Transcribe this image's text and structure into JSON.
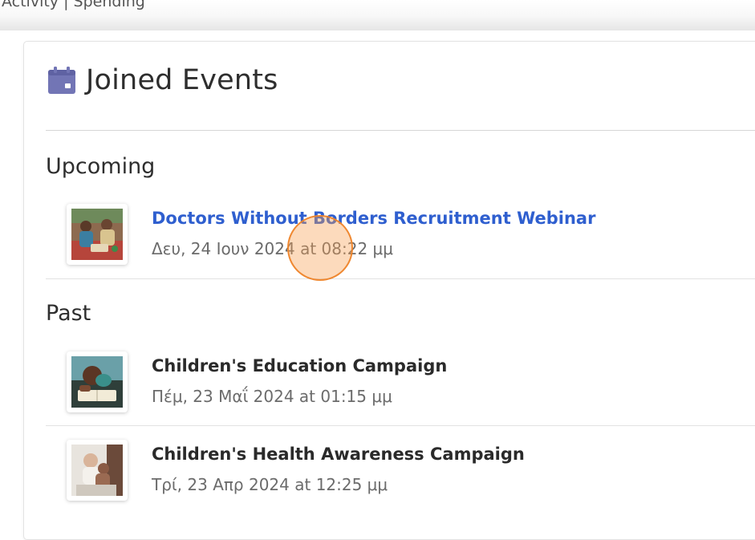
{
  "topbar": {
    "partial_text": "Activity | Spending"
  },
  "card": {
    "title": "Joined Events",
    "title_icon": "calendar-icon",
    "icon_color": "#7275b5"
  },
  "sections": {
    "upcoming": {
      "heading": "Upcoming",
      "events": [
        {
          "title": "Doctors Without Borders Recruitment Webinar",
          "date": "Δευ, 24 Ιουν 2024 at 08:22 μμ",
          "thumbnail": "volunteers-photo",
          "title_color": "#2f5fcf"
        }
      ]
    },
    "past": {
      "heading": "Past",
      "events": [
        {
          "title": "Children's Education Campaign",
          "date": "Πέμ, 23 Μαΐ 2024 at 01:15 μμ",
          "thumbnail": "child-reading-photo"
        },
        {
          "title": "Children's Health Awareness Campaign",
          "date": "Τρί, 23 Απρ 2024 at 12:25 μμ",
          "thumbnail": "mother-child-photo"
        }
      ]
    }
  },
  "colors": {
    "link": "#2f5fcf",
    "click_marker": "#f28c38"
  }
}
